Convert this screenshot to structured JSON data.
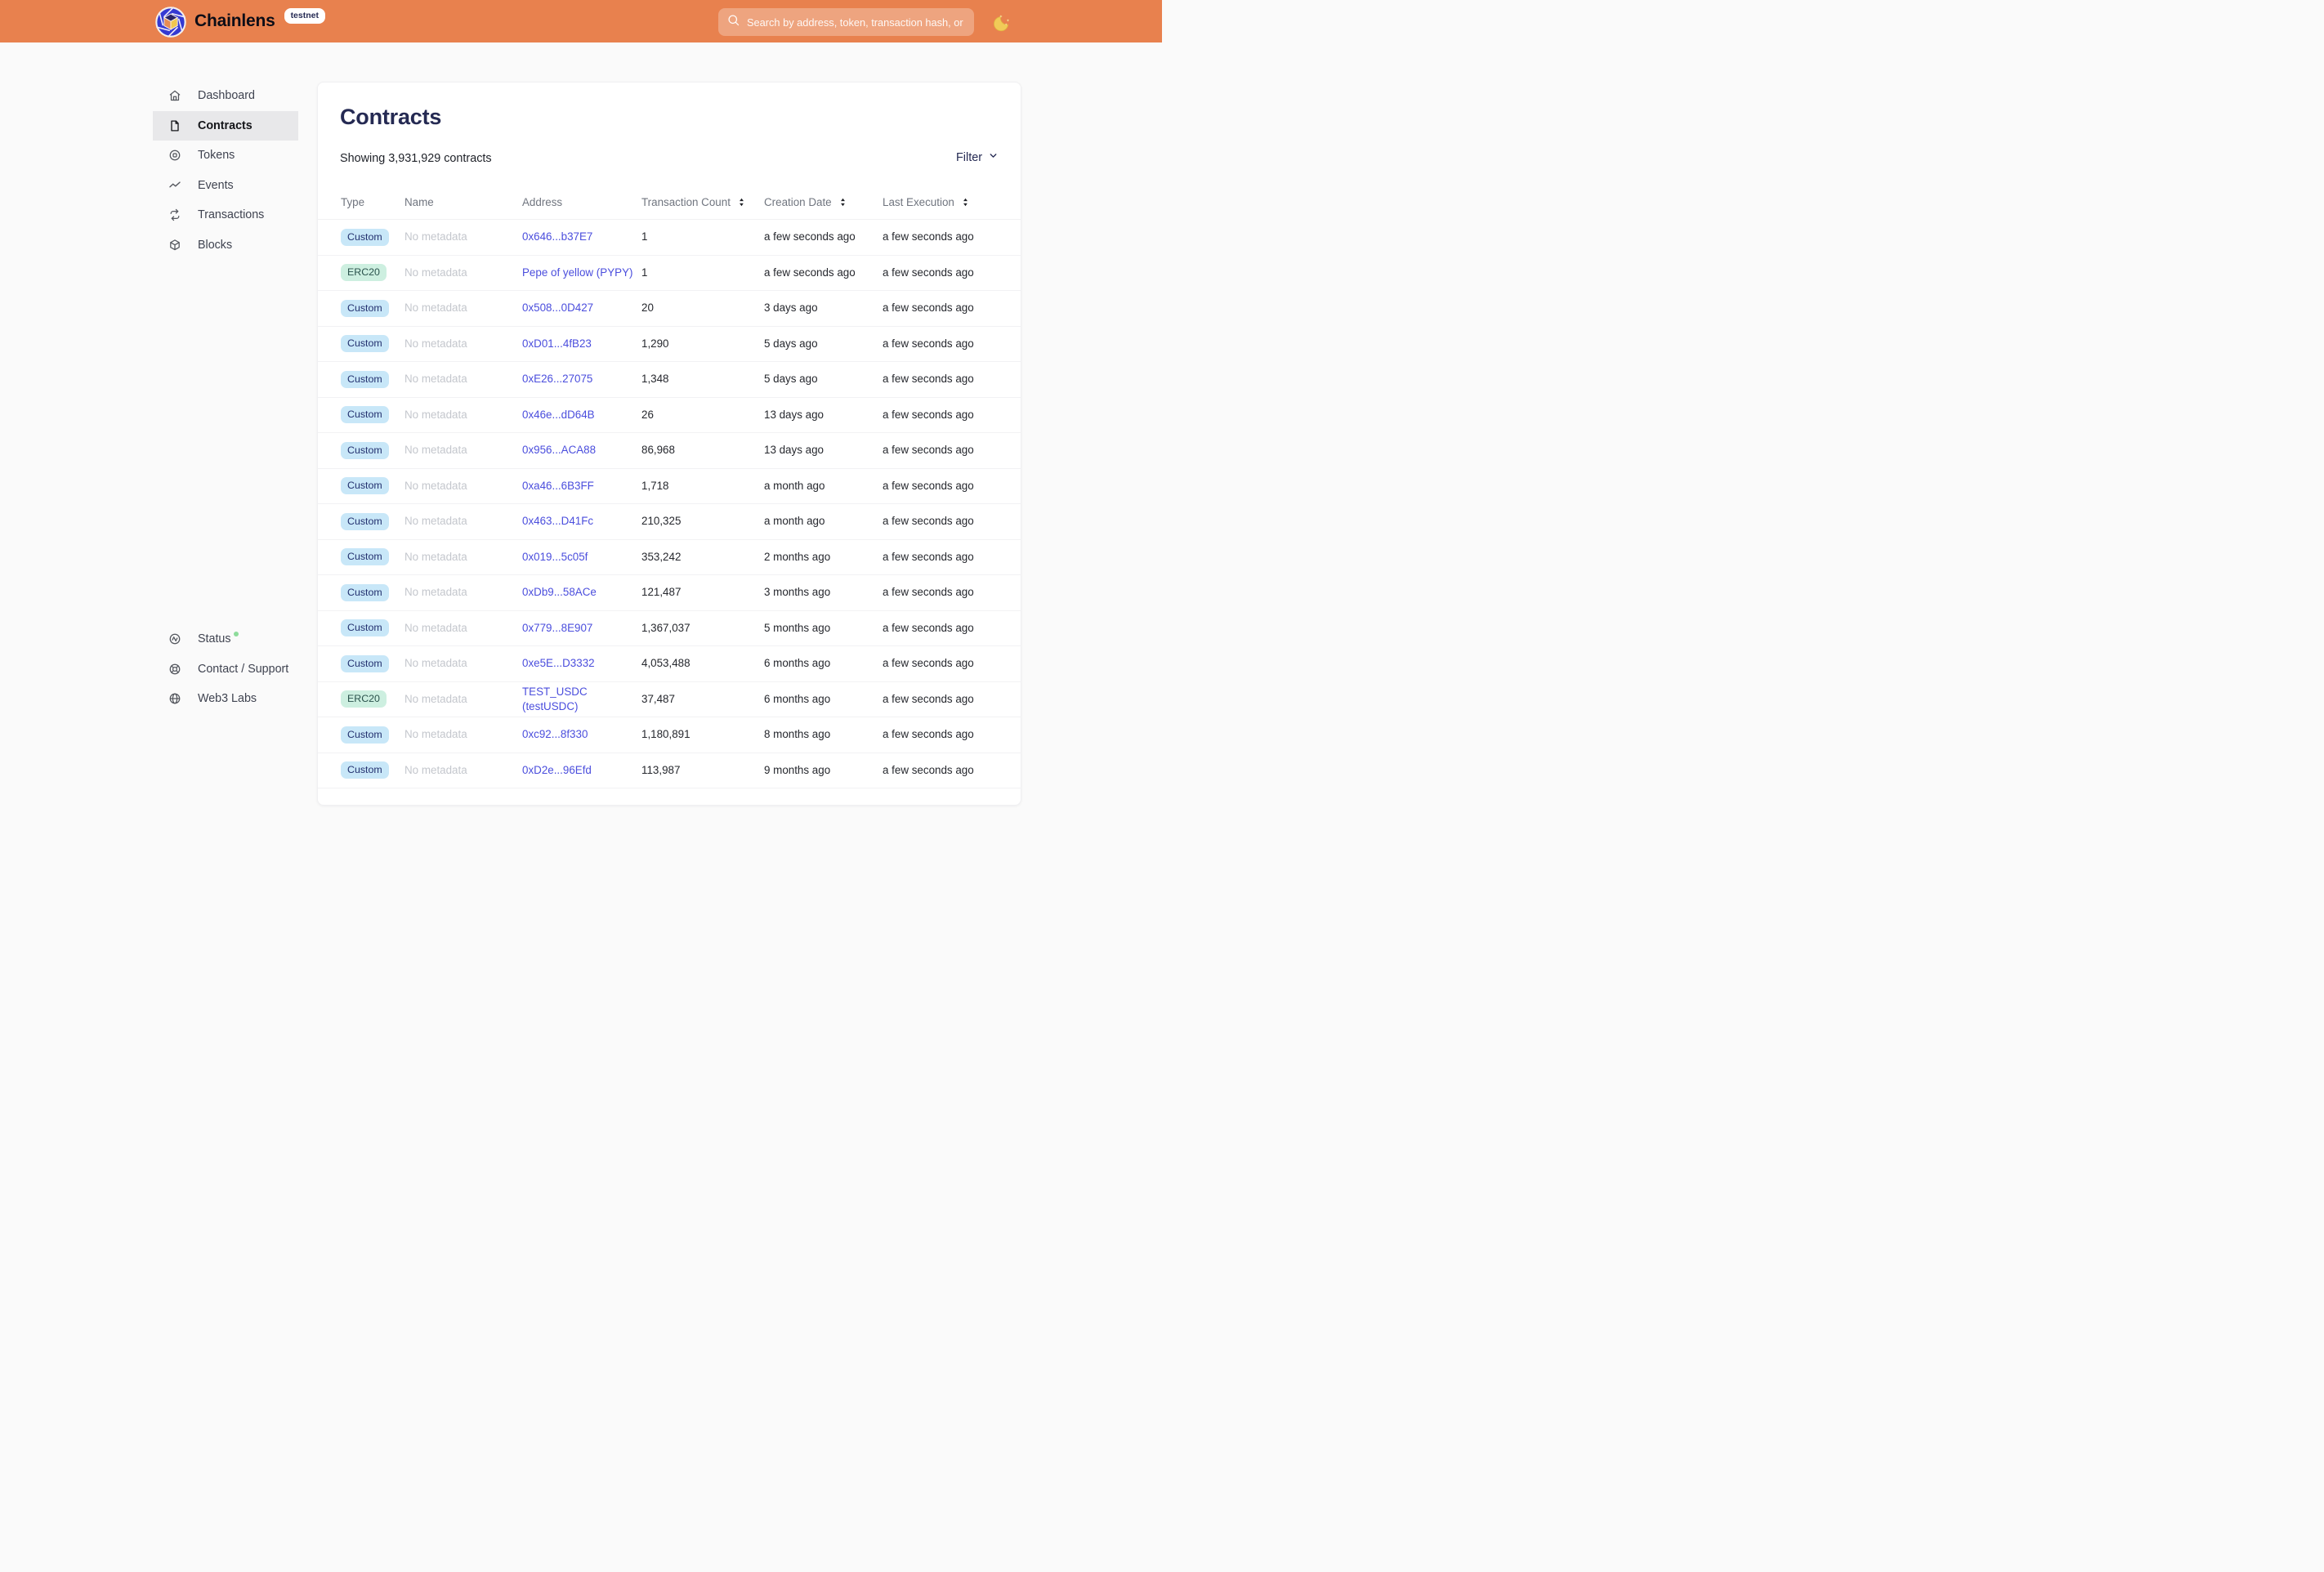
{
  "header": {
    "brand": "Chainlens",
    "env_badge": "testnet",
    "search_placeholder": "Search by address, token, transaction hash, or block number"
  },
  "sidebar": {
    "items": [
      {
        "label": "Dashboard",
        "icon": "home",
        "active": false
      },
      {
        "label": "Contracts",
        "icon": "contracts",
        "active": true
      },
      {
        "label": "Tokens",
        "icon": "tokens",
        "active": false
      },
      {
        "label": "Events",
        "icon": "events",
        "active": false
      },
      {
        "label": "Transactions",
        "icon": "transactions",
        "active": false
      },
      {
        "label": "Blocks",
        "icon": "blocks",
        "active": false
      }
    ],
    "footer_items": [
      {
        "label": "Status",
        "icon": "status",
        "online_dot": true
      },
      {
        "label": "Contact / Support",
        "icon": "support",
        "online_dot": false
      },
      {
        "label": "Web3 Labs",
        "icon": "globe",
        "online_dot": false
      }
    ]
  },
  "main": {
    "title": "Contracts",
    "summary": "Showing 3,931,929 contracts",
    "filter_label": "Filter",
    "table": {
      "columns": [
        {
          "label": "Type",
          "sortable": false
        },
        {
          "label": "Name",
          "sortable": false
        },
        {
          "label": "Address",
          "sortable": false
        },
        {
          "label": "Transaction Count",
          "sortable": true
        },
        {
          "label": "Creation Date",
          "sortable": true
        },
        {
          "label": "Last Execution",
          "sortable": true
        }
      ],
      "rows": [
        {
          "type": "Custom",
          "type_style": "blue",
          "name": "No metadata",
          "address": "0x646...b37E7",
          "tx_count": "1",
          "creation_date": "a few seconds ago",
          "last_execution": "a few seconds ago"
        },
        {
          "type": "ERC20",
          "type_style": "green",
          "name": "No metadata",
          "address": "Pepe of yellow (PYPY)",
          "tx_count": "1",
          "creation_date": "a few seconds ago",
          "last_execution": "a few seconds ago"
        },
        {
          "type": "Custom",
          "type_style": "blue",
          "name": "No metadata",
          "address": "0x508...0D427",
          "tx_count": "20",
          "creation_date": "3 days ago",
          "last_execution": "a few seconds ago"
        },
        {
          "type": "Custom",
          "type_style": "blue",
          "name": "No metadata",
          "address": "0xD01...4fB23",
          "tx_count": "1,290",
          "creation_date": "5 days ago",
          "last_execution": "a few seconds ago"
        },
        {
          "type": "Custom",
          "type_style": "blue",
          "name": "No metadata",
          "address": "0xE26...27075",
          "tx_count": "1,348",
          "creation_date": "5 days ago",
          "last_execution": "a few seconds ago"
        },
        {
          "type": "Custom",
          "type_style": "blue",
          "name": "No metadata",
          "address": "0x46e...dD64B",
          "tx_count": "26",
          "creation_date": "13 days ago",
          "last_execution": "a few seconds ago"
        },
        {
          "type": "Custom",
          "type_style": "blue",
          "name": "No metadata",
          "address": "0x956...ACA88",
          "tx_count": "86,968",
          "creation_date": "13 days ago",
          "last_execution": "a few seconds ago"
        },
        {
          "type": "Custom",
          "type_style": "blue",
          "name": "No metadata",
          "address": "0xa46...6B3FF",
          "tx_count": "1,718",
          "creation_date": "a month ago",
          "last_execution": "a few seconds ago"
        },
        {
          "type": "Custom",
          "type_style": "blue",
          "name": "No metadata",
          "address": "0x463...D41Fc",
          "tx_count": "210,325",
          "creation_date": "a month ago",
          "last_execution": "a few seconds ago"
        },
        {
          "type": "Custom",
          "type_style": "blue",
          "name": "No metadata",
          "address": "0x019...5c05f",
          "tx_count": "353,242",
          "creation_date": "2 months ago",
          "last_execution": "a few seconds ago"
        },
        {
          "type": "Custom",
          "type_style": "blue",
          "name": "No metadata",
          "address": "0xDb9...58ACe",
          "tx_count": "121,487",
          "creation_date": "3 months ago",
          "last_execution": "a few seconds ago"
        },
        {
          "type": "Custom",
          "type_style": "blue",
          "name": "No metadata",
          "address": "0x779...8E907",
          "tx_count": "1,367,037",
          "creation_date": "5 months ago",
          "last_execution": "a few seconds ago"
        },
        {
          "type": "Custom",
          "type_style": "blue",
          "name": "No metadata",
          "address": "0xe5E...D3332",
          "tx_count": "4,053,488",
          "creation_date": "6 months ago",
          "last_execution": "a few seconds ago"
        },
        {
          "type": "ERC20",
          "type_style": "green",
          "name": "No metadata",
          "address": "TEST_USDC (testUSDC)",
          "tx_count": "37,487",
          "creation_date": "6 months ago",
          "last_execution": "a few seconds ago"
        },
        {
          "type": "Custom",
          "type_style": "blue",
          "name": "No metadata",
          "address": "0xc92...8f330",
          "tx_count": "1,180,891",
          "creation_date": "8 months ago",
          "last_execution": "a few seconds ago"
        },
        {
          "type": "Custom",
          "type_style": "blue",
          "name": "No metadata",
          "address": "0xD2e...96Efd",
          "tx_count": "113,987",
          "creation_date": "9 months ago",
          "last_execution": "a few seconds ago"
        }
      ]
    }
  },
  "colors": {
    "header_bg": "#E8814E",
    "badge_custom_bg": "#C8E7F8",
    "badge_custom_text": "#22306E",
    "badge_erc20_bg": "#CDEFE0",
    "badge_erc20_text": "#2A524C",
    "link": "#4B4EDD",
    "active_nav_bg": "#E8E8EA",
    "status_dot": "#8EDC9B",
    "title": "#252A53"
  }
}
